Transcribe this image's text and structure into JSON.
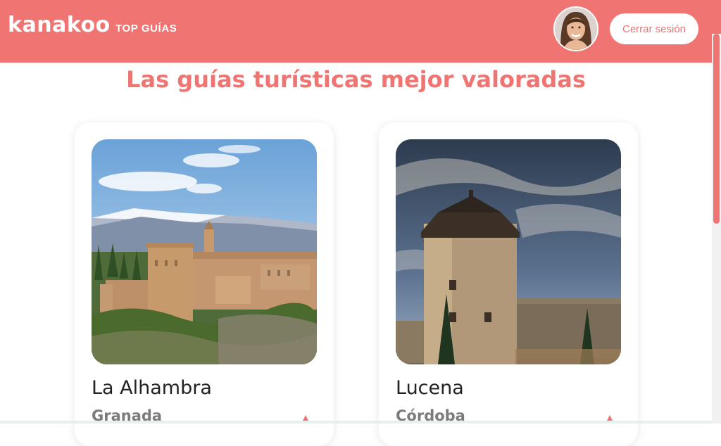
{
  "navbar": {
    "logo": "kanakoo",
    "links": [
      "TOP GUÍAS"
    ],
    "logout_label": "Cerrar sesión",
    "brand_color": "#f07471"
  },
  "main": {
    "title": "Las guías turísticas mejor valoradas",
    "cards": [
      {
        "title": "La Alhambra",
        "subtitle": "Granada",
        "image": "alhambra-photo"
      },
      {
        "title": "Lucena",
        "subtitle": "Córdoba",
        "image": "lucena-tower-photo"
      }
    ]
  }
}
